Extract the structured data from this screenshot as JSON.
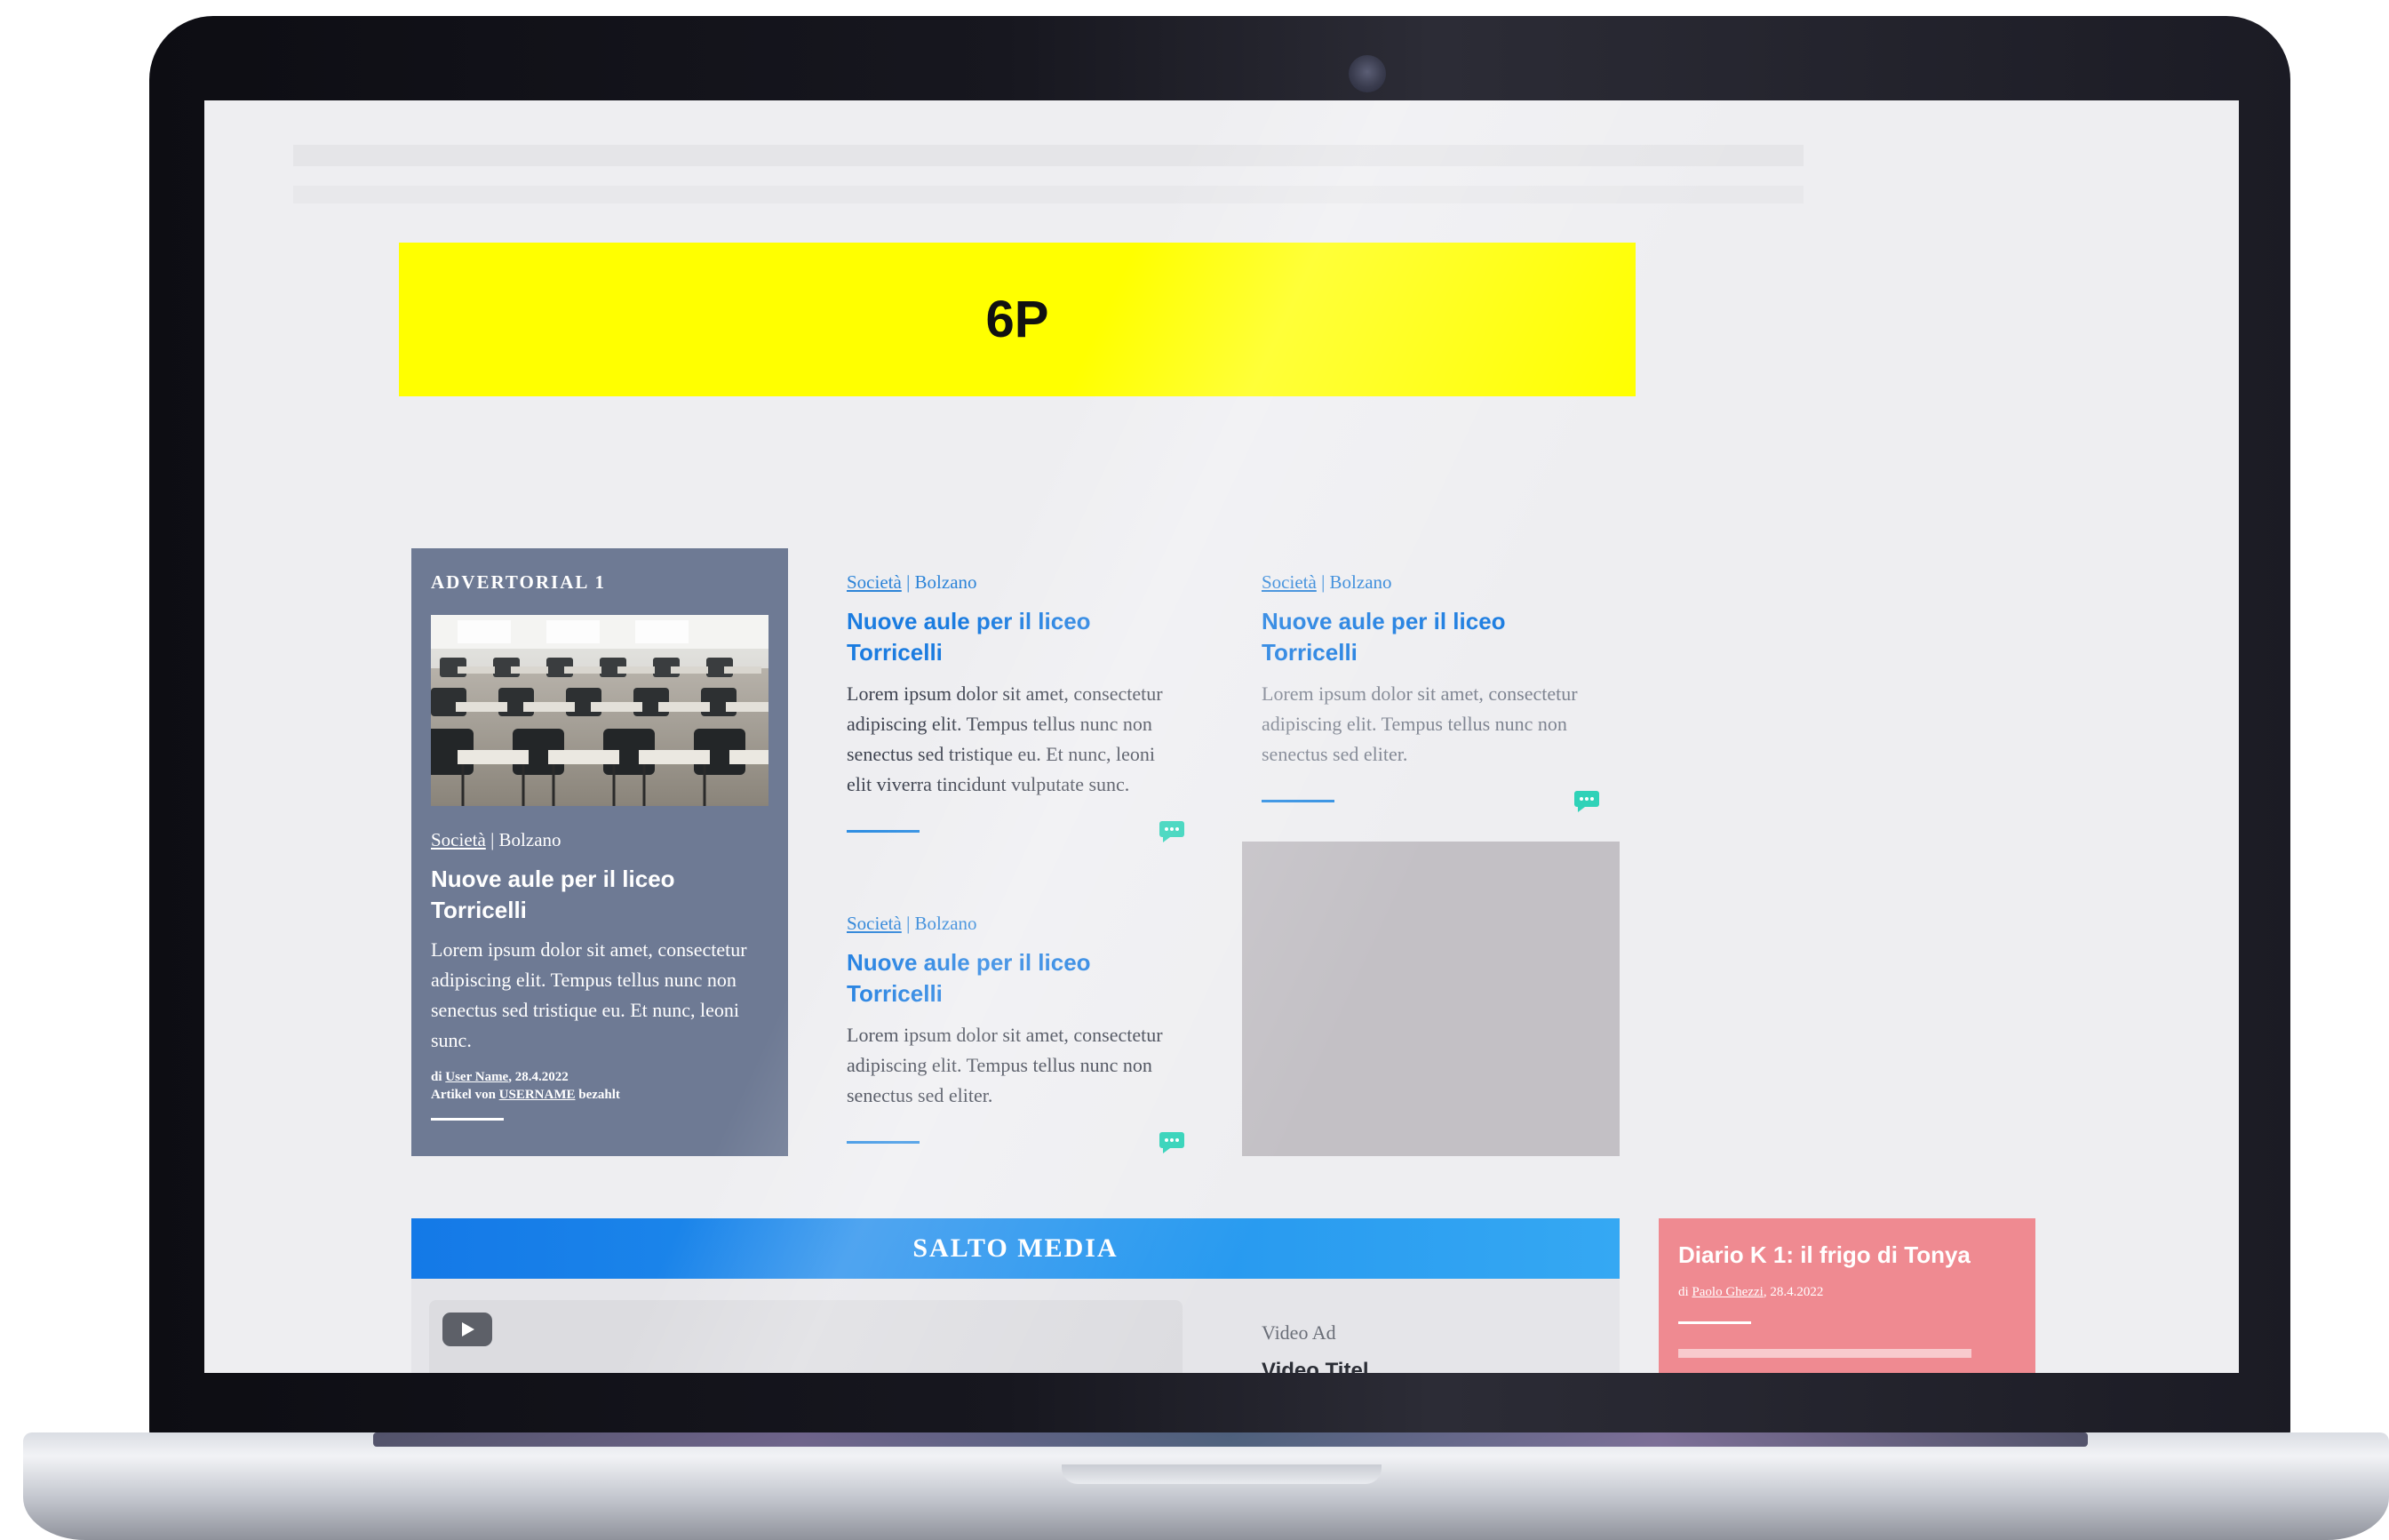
{
  "banner": {
    "label": "6P"
  },
  "advertorial": {
    "title": "ADVERTORIAL 1",
    "category": "Società",
    "separator": " | ",
    "location": "Bolzano",
    "headline": "Nuove aule per il liceo Torricelli",
    "body": "Lorem ipsum dolor sit amet, consectetur adipiscing elit. Tempus tellus nunc non senectus sed tristique eu. Et nunc, leoni sunc.",
    "meta_by": "di ",
    "author": "User Name",
    "date": ", 28.4.2022",
    "sponsor_prefix": "Artikel von ",
    "sponsor": "USERNAME",
    "sponsor_suffix": " bezahlt",
    "image_alt": "classroom-photo"
  },
  "articles": [
    {
      "category": "Società",
      "separator": " | ",
      "location": "Bolzano",
      "headline": "Nuove aule per il liceo Torricelli",
      "body": "Lorem ipsum dolor sit amet, consectetur adipiscing elit. Tempus tellus nunc non senectus sed tristique eu. Et nunc, leoni elit viverra tincidunt vulputate sunc."
    },
    {
      "category": "Società",
      "separator": " | ",
      "location": "Bolzano",
      "headline": "Nuove aule per il liceo Torricelli",
      "body": "Lorem ipsum dolor sit amet, consectetur adipiscing elit. Tempus tellus nunc non senectus sed eliter."
    },
    {
      "category": "Società",
      "separator": " | ",
      "location": "Bolzano",
      "headline": "Nuove aule per il liceo Torricelli",
      "body": "Lorem ipsum dolor sit amet, consectetur adipiscing elit. Tempus tellus nunc non senectus sed eliter."
    }
  ],
  "media": {
    "section_title": "SALTO MEDIA",
    "video_ad_label": "Video Ad",
    "video_title": "Video Titel"
  },
  "diary": {
    "title": "Diario K 1: il frigo di Tonya",
    "meta_by": "di ",
    "author": "Paolo Ghezzi",
    "date": ", 28.4.2022"
  },
  "colors": {
    "banner": "#ffff00",
    "advertorial_bg": "#6e7a94",
    "link_blue": "#1b7ce0",
    "comment_icon": "#2fd2b8",
    "salto_bar": "#1479e7",
    "diary_bg": "#ef8a91"
  },
  "icons": [
    "comment-icon",
    "play-icon",
    "camera"
  ]
}
